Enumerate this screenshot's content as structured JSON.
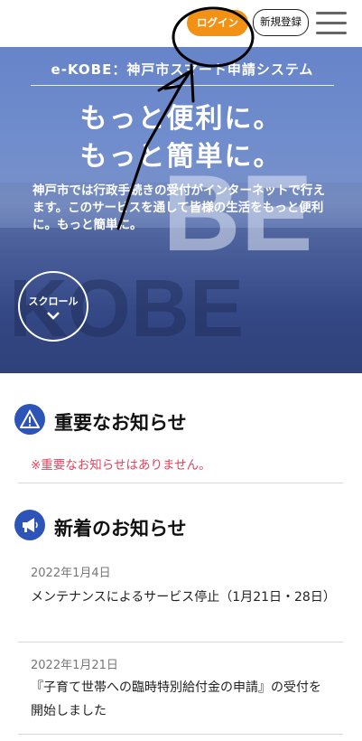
{
  "header": {
    "login_label": "ログイン",
    "register_label": "新規登録"
  },
  "hero": {
    "tagline": "e-KOBE：神戸市スマート申請システム",
    "headline_line1": "もっと便利に。",
    "headline_line2": "もっと簡単に。",
    "description": "神戸市では行政手続きの受付がインターネットで行えます。このサービスを通して皆様の生活をもっと便利に。もっと簡単に。",
    "scroll_label": "スクロール"
  },
  "important": {
    "title": "重要なお知らせ",
    "notice": "※重要なお知らせはありません。"
  },
  "news": {
    "title": "新着のお知らせ",
    "items": [
      {
        "date": "2022年1月4日",
        "text": "メンテナンスによるサービス停止（1月21日・28日）"
      },
      {
        "date": "2022年1月21日",
        "text": "『子育て世帯への臨時特別給付金の申請』の受付を開始しました"
      }
    ]
  },
  "colors": {
    "accent_orange": "#f29114",
    "brand_blue": "#2d55b7",
    "notice_red": "#e0445e"
  },
  "icons": [
    "menu-icon",
    "chevron-down-icon",
    "warning-icon",
    "megaphone-icon"
  ]
}
